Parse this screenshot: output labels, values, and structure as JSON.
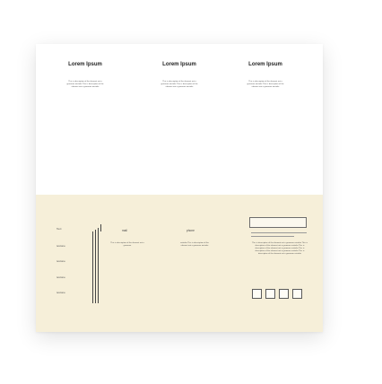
{
  "header": {
    "columns": [
      {
        "heading": "Lorem Ipsum",
        "description": "This is description of the element not a grammar mistake This is description of the element not a grammar mistake"
      },
      {
        "heading": "Lorem Ipsum",
        "description": "This is description of the element not a grammar mistake This is description of the element not a grammar mistake"
      },
      {
        "heading": "Lorem Ipsum",
        "description": "This is description of the element not a grammar mistake This is description of the element not a grammar mistake"
      }
    ]
  },
  "table": {
    "first_label": "Text",
    "row_labels": [
      "textone",
      "textone",
      "textone",
      "textone"
    ],
    "mail_label": "mail",
    "phone_label": "phone",
    "mail_description": "This is description of the element not a grammar",
    "phone_description": "mistake This is description of the element not a grammar mistake"
  },
  "sidebar": {
    "long_description": "This is description of the element not a grammar mistake This is description of the element not a grammar mistake This is description of the element not a grammar mistake This is description of the element not a grammar mistake This is description of the element not a grammar mistake"
  }
}
